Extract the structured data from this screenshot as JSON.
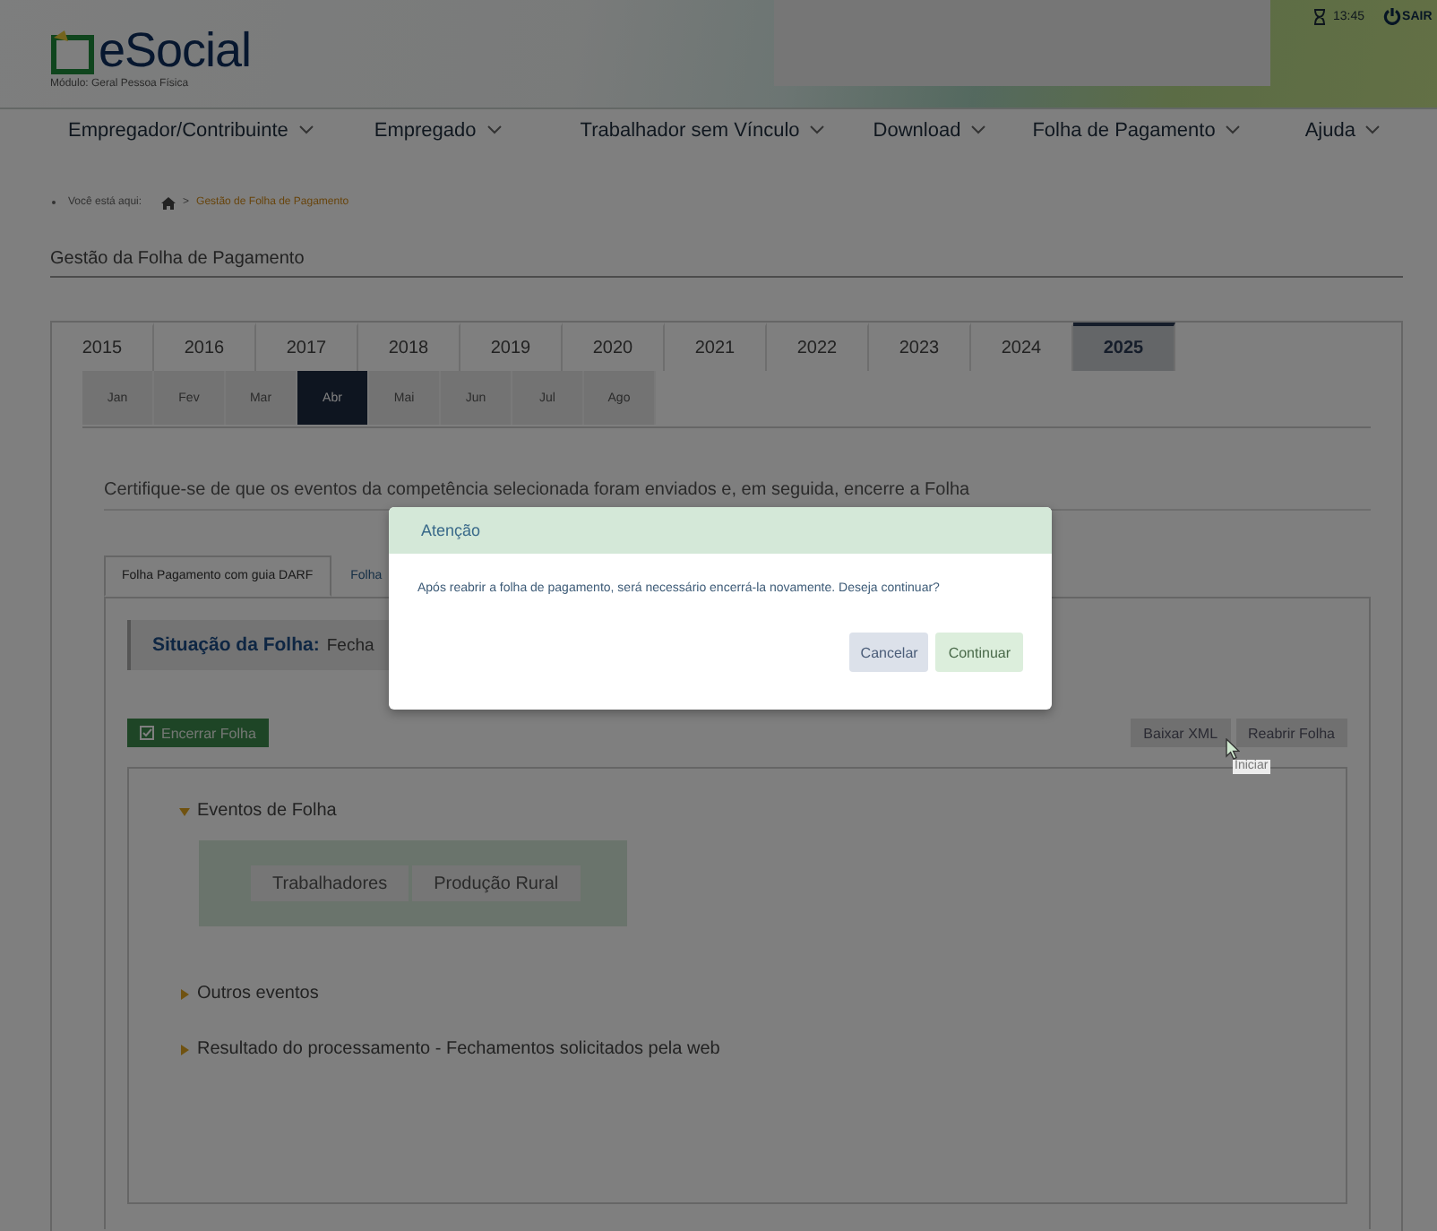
{
  "header": {
    "logo_text": "eSocial",
    "module": "Módulo: Geral Pessoa Física",
    "timer": "13:45",
    "logout": "SAIR"
  },
  "nav": [
    {
      "label": "Empregador/Contribuinte"
    },
    {
      "label": "Empregado"
    },
    {
      "label": "Trabalhador sem Vínculo"
    },
    {
      "label": "Download"
    },
    {
      "label": "Folha de Pagamento"
    },
    {
      "label": "Ajuda"
    }
  ],
  "breadcrumb": {
    "prefix": "Você está aqui:",
    "separator": ">",
    "current": "Gestão de Folha de Pagamento"
  },
  "page_title": "Gestão da Folha de Pagamento",
  "years": [
    {
      "label": "2015",
      "selected": false
    },
    {
      "label": "2016",
      "selected": false
    },
    {
      "label": "2017",
      "selected": false
    },
    {
      "label": "2018",
      "selected": false
    },
    {
      "label": "2019",
      "selected": false
    },
    {
      "label": "2020",
      "selected": false
    },
    {
      "label": "2021",
      "selected": false
    },
    {
      "label": "2022",
      "selected": false
    },
    {
      "label": "2023",
      "selected": false
    },
    {
      "label": "2024",
      "selected": false
    },
    {
      "label": "2025",
      "selected": true
    }
  ],
  "months": [
    {
      "label": "Jan",
      "selected": false
    },
    {
      "label": "Fev",
      "selected": false
    },
    {
      "label": "Mar",
      "selected": false
    },
    {
      "label": "Abr",
      "selected": true
    },
    {
      "label": "Mai",
      "selected": false
    },
    {
      "label": "Jun",
      "selected": false
    },
    {
      "label": "Jul",
      "selected": false
    },
    {
      "label": "Ago",
      "selected": false
    }
  ],
  "instruction": "Certifique-se de que os eventos da competência selecionada foram enviados e, em seguida, encerre a Folha",
  "subtabs": [
    {
      "label": "Folha Pagamento com guia DARF",
      "selected": true
    },
    {
      "label": "Folha",
      "selected": false
    }
  ],
  "status": {
    "label": "Situação da Folha:",
    "value": "Fecha"
  },
  "close_button": "Encerrar Folha",
  "action_buttons": [
    "Baixar XML",
    "Reabrir Folha"
  ],
  "tooltip": "Iniciar",
  "sections": [
    {
      "label": "Eventos de Folha",
      "expanded": true,
      "buttons": [
        "Trabalhadores",
        "Produção Rural"
      ]
    },
    {
      "label": "Outros eventos",
      "expanded": false
    },
    {
      "label": "Resultado do processamento - Fechamentos solicitados pela web",
      "expanded": false
    }
  ],
  "dialog": {
    "title": "Atenção",
    "message": "Após reabrir a folha de pagamento, será necessário encerrá-la novamente. Deseja continuar?",
    "buttons": [
      {
        "label": "Cancelar",
        "kind": "secondary"
      },
      {
        "label": "Continuar",
        "kind": "primary"
      }
    ]
  }
}
